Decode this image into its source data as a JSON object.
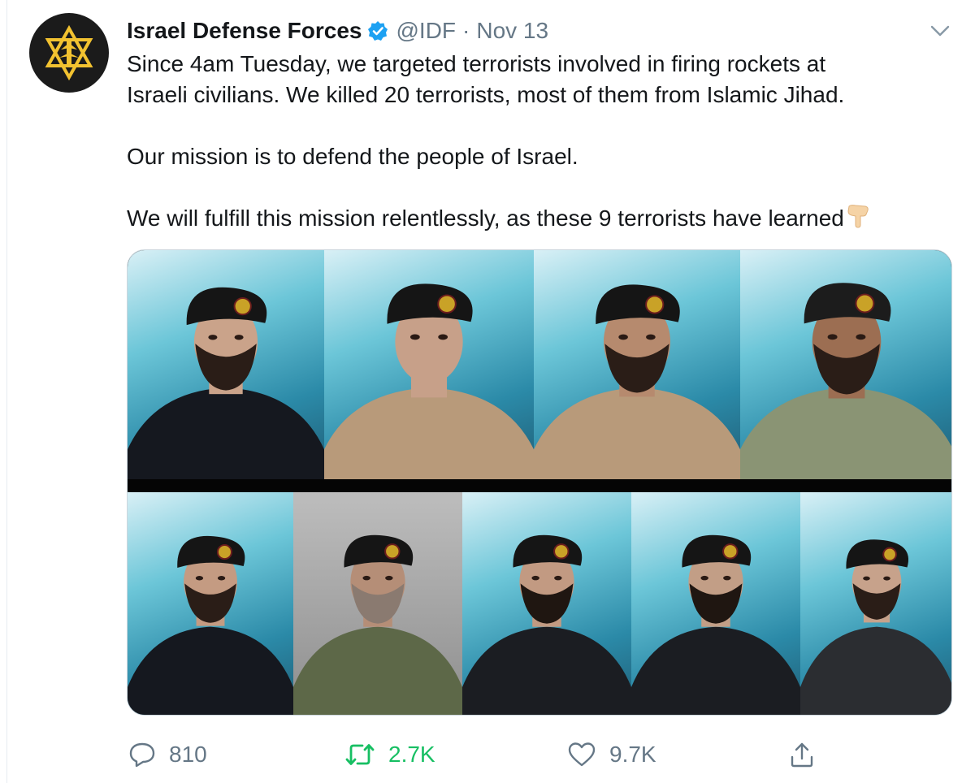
{
  "tweet": {
    "author_name": "Israel Defense Forces",
    "handle": "@IDF",
    "separator": "·",
    "date": "Nov 13",
    "lines": [
      "Since 4am Tuesday, we targeted terrorists involved in firing rockets at",
      "Israeli civilians. We killed 20 terrorists, most of them from Islamic Jihad.",
      "",
      "Our mission is to defend the people of Israel.",
      "",
      "We will fulfill this mission relentlessly, as these 9 terrorists have learned"
    ],
    "emoji_name": "backhand-index-pointing-down-icon"
  },
  "media": {
    "photo_count": 9,
    "row1_count": 4,
    "row2_count": 5
  },
  "actions": {
    "replies": "810",
    "retweets": "2.7K",
    "likes": "9.7K"
  },
  "colors": {
    "text": "#14171a",
    "muted": "#657786",
    "verified": "#1da1f2",
    "retweet_active": "#17bf63",
    "logo_gold": "#f2c230"
  },
  "icons": {
    "reply": "reply-icon",
    "retweet": "retweet-icon",
    "like": "heart-icon",
    "share": "share-icon",
    "caret": "chevron-down-icon",
    "verified": "verified-badge-icon"
  }
}
